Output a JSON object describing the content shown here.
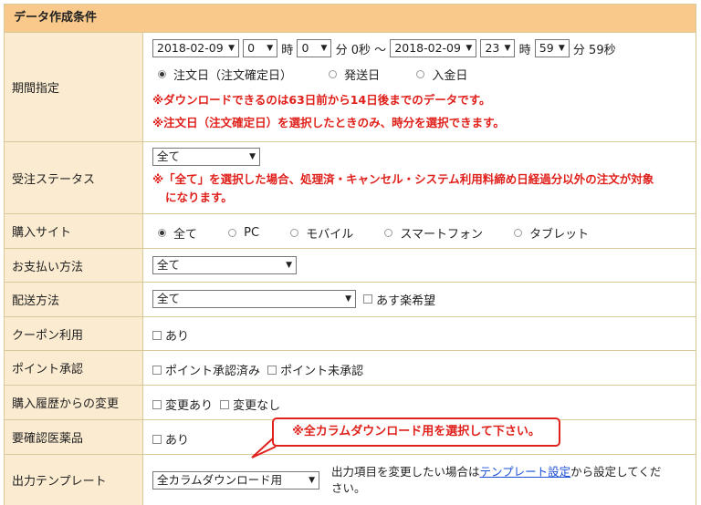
{
  "panel_title": "データ作成条件",
  "period": {
    "label": "期間指定",
    "start_date": "2018-02-09",
    "start_hour": "0",
    "start_min": "0",
    "hour_unit": "時",
    "min_unit": "分",
    "start_sec": "0秒",
    "tilde": "～",
    "end_date": "2018-02-09",
    "end_hour": "23",
    "end_min": "59",
    "end_sec": "59秒",
    "date_types": [
      "注文日（注文確定日）",
      "発送日",
      "入金日"
    ],
    "note1": "※ダウンロードできるのは63日前から14日後までのデータです。",
    "note2": "※注文日（注文確定日）を選択したときのみ、時分を選択できます。"
  },
  "order_status": {
    "label": "受注ステータス",
    "value": "全て",
    "note_line1": "※「全て」を選択した場合、処理済・キャンセル・システム利用料締め日経過分以外の注文が対象",
    "note_line2": "になります。"
  },
  "purchase_site": {
    "label": "購入サイト",
    "options": [
      "全て",
      "PC",
      "モバイル",
      "スマートフォン",
      "タブレット"
    ]
  },
  "payment": {
    "label": "お支払い方法",
    "value": "全て"
  },
  "delivery": {
    "label": "配送方法",
    "value": "全て",
    "checkbox": "あす楽希望"
  },
  "coupon": {
    "label": "クーポン利用",
    "checkbox": "あり"
  },
  "points": {
    "label": "ポイント承認",
    "checkbox1": "ポイント承認済み",
    "checkbox2": "ポイント未承認"
  },
  "history": {
    "label": "購入履歴からの変更",
    "checkbox1": "変更あり",
    "checkbox2": "変更なし"
  },
  "medicine": {
    "label": "要確認医薬品",
    "checkbox": "あり"
  },
  "template": {
    "label": "出力テンプレート",
    "value": "全カラムダウンロード用",
    "desc_pre": "出力項目を変更したい場合は",
    "link": "テンプレート設定",
    "desc_post": "から設定してくだ",
    "desc_line2": "さい。"
  },
  "callout": {
    "text": "※全カラムダウンロード用を選択して下さい。"
  },
  "colors": {
    "header": "#f8c98a",
    "label_bg": "#fbebd0",
    "border": "#d9c89a",
    "alert": "#e0201b",
    "link": "#1a4fd6"
  }
}
